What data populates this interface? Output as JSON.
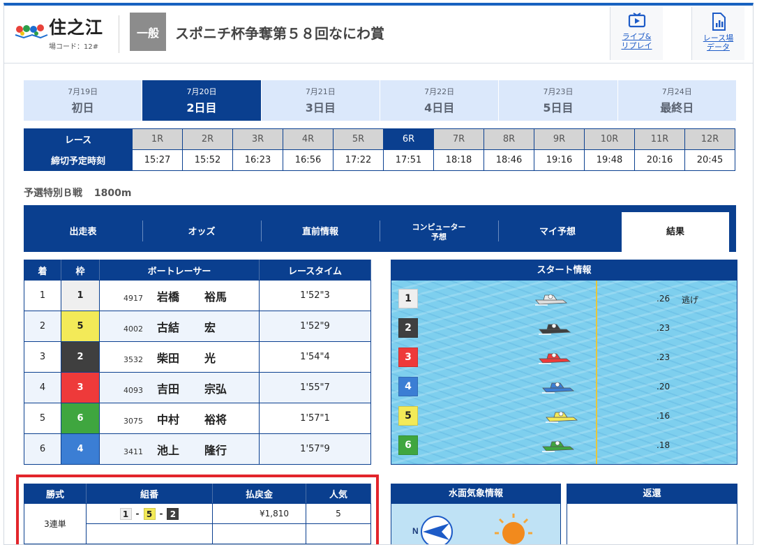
{
  "header": {
    "venue": "住之江",
    "venue_code": "場コード：12#",
    "grade": "一般",
    "race_title": "スポニチ杯争奪第５８回なにわ賞",
    "live_btn": [
      "ライブ&",
      "リプレイ"
    ],
    "data_btn": [
      "レース場",
      "データ"
    ]
  },
  "days": [
    {
      "date": "7月19日",
      "label": "初日",
      "active": false
    },
    {
      "date": "7月20日",
      "label": "2日目",
      "active": true
    },
    {
      "date": "7月21日",
      "label": "3日目",
      "active": false
    },
    {
      "date": "7月22日",
      "label": "4日目",
      "active": false
    },
    {
      "date": "7月23日",
      "label": "5日目",
      "active": false
    },
    {
      "date": "7月24日",
      "label": "最終日",
      "active": false
    }
  ],
  "race_grid": {
    "row1_label": "レース",
    "row2_label": "締切予定時刻",
    "races": [
      "1R",
      "2R",
      "3R",
      "4R",
      "5R",
      "6R",
      "7R",
      "8R",
      "9R",
      "10R",
      "11R",
      "12R"
    ],
    "times": [
      "15:27",
      "15:52",
      "16:23",
      "16:56",
      "17:22",
      "17:51",
      "18:18",
      "18:46",
      "19:16",
      "19:48",
      "20:16",
      "20:45"
    ],
    "active_race": "6R"
  },
  "race_info": {
    "name": "予選特別Ｂ戦",
    "distance": "1800m"
  },
  "nav_tabs": [
    {
      "label": "出走表",
      "active": false
    },
    {
      "label": "オッズ",
      "active": false
    },
    {
      "label": "直前情報",
      "active": false
    },
    {
      "label": "コンピューター\n予想",
      "active": false
    },
    {
      "label": "マイ予想",
      "active": false
    },
    {
      "label": "結果",
      "active": true
    }
  ],
  "colors": {
    "1": "#efefef",
    "2": "#3f3f3f",
    "3": "#ee3a3a",
    "4": "#3b7ed4",
    "5": "#f3ea58",
    "6": "#3fa63f"
  },
  "results": {
    "headers": [
      "着",
      "枠",
      "ボートレーサー",
      "レースタイム"
    ],
    "rows": [
      {
        "rank": "1",
        "frame": "1",
        "reg": "4917",
        "family": "岩橋",
        "given": "裕馬",
        "time": "1'52\"3"
      },
      {
        "rank": "2",
        "frame": "5",
        "reg": "4002",
        "family": "古結",
        "given": "宏",
        "time": "1'52\"9"
      },
      {
        "rank": "3",
        "frame": "2",
        "reg": "3532",
        "family": "柴田",
        "given": "光",
        "time": "1'54\"4"
      },
      {
        "rank": "4",
        "frame": "3",
        "reg": "4093",
        "family": "吉田",
        "given": "宗弘",
        "time": "1'55\"7"
      },
      {
        "rank": "5",
        "frame": "6",
        "reg": "3075",
        "family": "中村",
        "given": "裕将",
        "time": "1'57\"1"
      },
      {
        "rank": "6",
        "frame": "4",
        "reg": "3411",
        "family": "池上",
        "given": "隆行",
        "time": "1'57\"9"
      }
    ]
  },
  "start_info": {
    "title": "スタート情報",
    "rows": [
      {
        "course": "1",
        "st": ".26",
        "note": "逃げ",
        "pos": 0.44
      },
      {
        "course": "2",
        "st": ".23",
        "note": "",
        "pos": 0.45
      },
      {
        "course": "3",
        "st": ".23",
        "note": "",
        "pos": 0.45
      },
      {
        "course": "4",
        "st": ".20",
        "note": "",
        "pos": 0.46
      },
      {
        "course": "5",
        "st": ".16",
        "note": "",
        "pos": 0.47
      },
      {
        "course": "6",
        "st": ".18",
        "note": "",
        "pos": 0.46
      }
    ]
  },
  "payout": {
    "headers": [
      "勝式",
      "組番",
      "払戻金",
      "人気"
    ],
    "bet_type": "3連単",
    "combo": [
      "1",
      "5",
      "2"
    ],
    "amount": "¥1,810",
    "popularity": "5"
  },
  "weather": {
    "title": "水面気象情報",
    "wind_dir_label": "N"
  },
  "refund": {
    "title": "返還"
  }
}
